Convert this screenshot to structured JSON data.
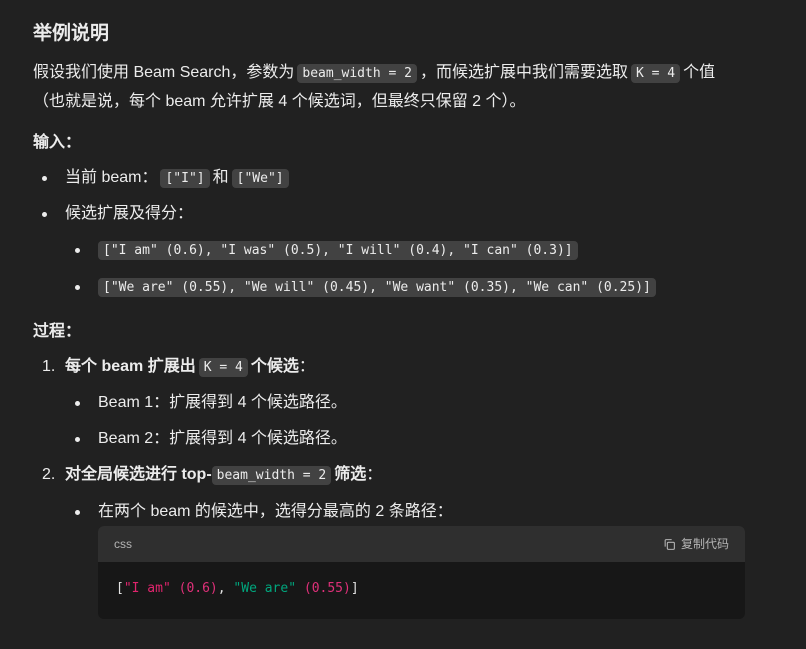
{
  "section1": {
    "title": "举例说明",
    "intro_line1_a": "假设我们使用 Beam Search，参数为",
    "intro_code1": "beam_width = 2",
    "intro_line1_b": "，而候选扩展中我们需要选取",
    "intro_code2": "K = 4",
    "intro_line1_c": "个值",
    "intro_line2": "（也就是说，每个 beam 允许扩展 4 个候选词，但最终只保留 2 个）。"
  },
  "input": {
    "heading": "输入：",
    "current_beam_label": "当前 beam：",
    "beam_code1": "[\"I\"]",
    "and_text": "和",
    "beam_code2": "[\"We\"]",
    "candidates_label": "候选扩展及得分：",
    "cand_list1": "[\"I am\" (0.6), \"I was\" (0.5), \"I will\" (0.4), \"I can\" (0.3)]",
    "cand_list2": "[\"We are\" (0.55), \"We will\" (0.45), \"We want\" (0.35), \"We can\" (0.25)]"
  },
  "process": {
    "heading": "过程：",
    "step1_num": "1.",
    "step1_a": "每个 beam 扩展出",
    "step1_code": "K = 4",
    "step1_b": "个候选",
    "step1_colon": "：",
    "beam1": "Beam 1：扩展得到 4 个候选路径。",
    "beam2": "Beam 2：扩展得到 4 个候选路径。",
    "step2_num": "2.",
    "step2_a": "对全局候选进行 top-",
    "step2_code": "beam_width = 2",
    "step2_b": "筛选",
    "step2_colon": "：",
    "select_text": "在两个 beam 的候选中，选得分最高的 2 条路径："
  },
  "codeblock": {
    "lang": "css",
    "copy_label": "复制代码",
    "tokens": {
      "open": "[",
      "s1": "\"I am\"",
      "n1": "(0.6)",
      "comma": ",",
      "s2": "\"We are\"",
      "n2": "(0.55)",
      "close": "]"
    }
  },
  "colors": {
    "background": "#212121",
    "code_bg": "#171717",
    "code_header": "#2f2f2f",
    "inline_code_bg": "#424242",
    "string_pink": "#e0246d",
    "string_green": "#00a67d"
  }
}
